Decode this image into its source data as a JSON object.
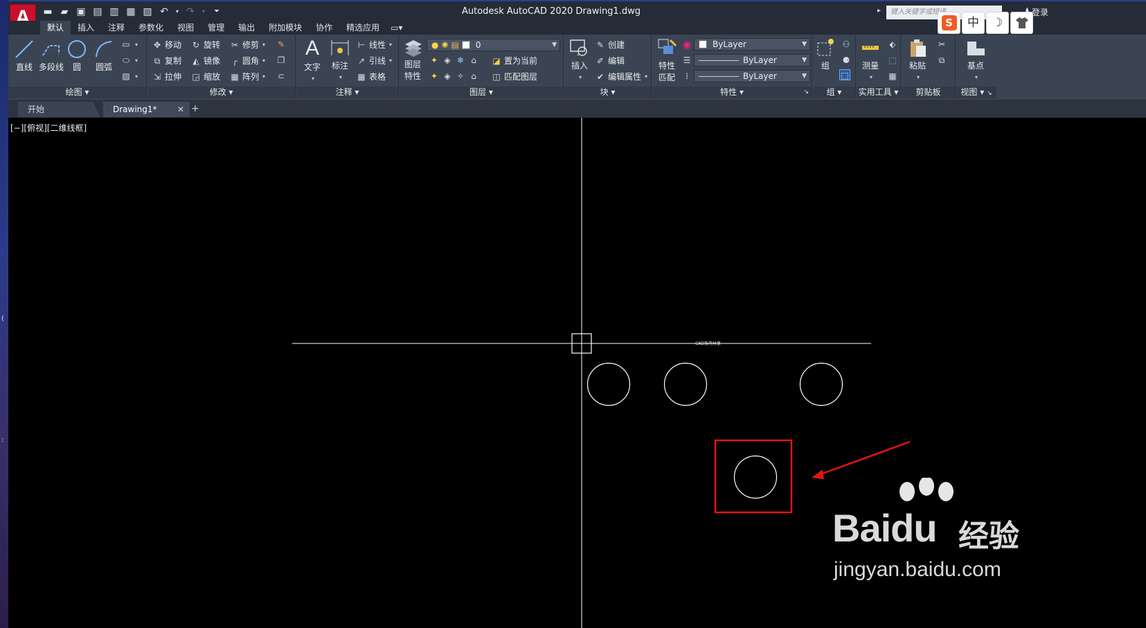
{
  "app": {
    "logo_letter": "A",
    "title": "Autodesk AutoCAD 2020    Drawing1.dwg",
    "search_placeholder": "键入关键字或短语",
    "login": "登录"
  },
  "ime": {
    "brand": "S",
    "mode": "中",
    "moon": "☽",
    "skin": "👕"
  },
  "ribbon_tabs": [
    "默认",
    "插入",
    "注释",
    "参数化",
    "视图",
    "管理",
    "输出",
    "附加模块",
    "协作",
    "精选应用"
  ],
  "panels": {
    "draw": {
      "title": "绘图",
      "line": "直线",
      "polyline": "多段线",
      "circle": "圆",
      "arc": "圆弧"
    },
    "modify": {
      "title": "修改",
      "move": "移动",
      "rotate": "旋转",
      "trim": "修剪",
      "copy": "复制",
      "mirror": "镜像",
      "fillet": "圆角",
      "stretch": "拉伸",
      "scale": "缩放",
      "array": "阵列"
    },
    "annotation": {
      "title": "注释",
      "text": "文字",
      "dimension": "标注",
      "linear": "线性",
      "leader": "引线",
      "table": "表格"
    },
    "layers": {
      "title": "图层",
      "layer_props_1": "图层",
      "layer_props_2": "特性",
      "current_layer": "0",
      "set_current": "置为当前",
      "match_layer": "匹配图层"
    },
    "block": {
      "title": "块",
      "insert": "插入",
      "create": "创建",
      "edit": "编辑",
      "edit_attr": "编辑属性"
    },
    "properties": {
      "title": "特性",
      "match_1": "特性",
      "match_2": "匹配",
      "color": "ByLayer",
      "linetype": "ByLayer",
      "lineweight": "ByLayer"
    },
    "groups": {
      "title": "组",
      "group": "组"
    },
    "utilities": {
      "title": "实用工具",
      "measure": "测量"
    },
    "clipboard": {
      "title": "剪贴板",
      "paste": "粘贴"
    },
    "view": {
      "title": "视图",
      "base": "基点"
    }
  },
  "file_tabs": {
    "start": "开始",
    "drawing": "Drawing1*"
  },
  "viewport_label": "[−][俯视][二维线框]",
  "drawing": {
    "tiny_text": "CAD技巧分享",
    "circles_count": 4,
    "highlight_color": "#e01515"
  },
  "watermark": {
    "brand": "Baidu",
    "suffix": "经验",
    "url": "jingyan.baidu.com"
  }
}
